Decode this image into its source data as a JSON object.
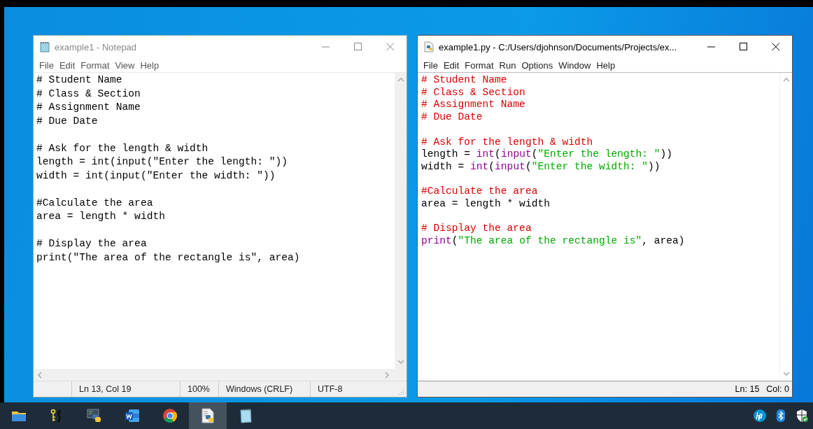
{
  "notepad": {
    "title": "example1 - Notepad",
    "active": false,
    "menu": [
      "File",
      "Edit",
      "Format",
      "View",
      "Help"
    ],
    "blocks": [
      [
        "# Student Name",
        "# Class & Section",
        "# Assignment Name",
        "# Due Date"
      ],
      [
        "# Ask for the length & width",
        "length = int(input(\"Enter the length: \"))",
        "width = int(input(\"Enter the width: \"))"
      ],
      [
        "#Calculate the area",
        "area = length * width"
      ],
      [
        "# Display the area",
        "print(\"The area of the rectangle is\", area)"
      ]
    ],
    "status": {
      "position": "Ln 13, Col 19",
      "zoom": "100%",
      "line_ending": "Windows (CRLF)",
      "encoding": "UTF-8"
    }
  },
  "idle": {
    "title": "example1.py - C:/Users/djohnson/Documents/Projects/ex...",
    "active": true,
    "menu": [
      "File",
      "Edit",
      "Format",
      "Run",
      "Options",
      "Window",
      "Help"
    ],
    "blocks": [
      [
        [
          {
            "kind": "comment",
            "text": "# Student Name"
          }
        ],
        [
          {
            "kind": "comment",
            "text": "# Class & Section"
          }
        ],
        [
          {
            "kind": "comment",
            "text": "# Assignment Name"
          }
        ],
        [
          {
            "kind": "comment",
            "text": "# Due Date"
          }
        ]
      ],
      [
        [
          {
            "kind": "comment",
            "text": "# Ask for the length & width"
          }
        ],
        [
          {
            "kind": "plain",
            "text": "length = "
          },
          {
            "kind": "builtin",
            "text": "int"
          },
          {
            "kind": "plain",
            "text": "("
          },
          {
            "kind": "builtin",
            "text": "input"
          },
          {
            "kind": "plain",
            "text": "("
          },
          {
            "kind": "string",
            "text": "\"Enter the length: \""
          },
          {
            "kind": "plain",
            "text": "))"
          }
        ],
        [
          {
            "kind": "plain",
            "text": "width = "
          },
          {
            "kind": "builtin",
            "text": "int"
          },
          {
            "kind": "plain",
            "text": "("
          },
          {
            "kind": "builtin",
            "text": "input"
          },
          {
            "kind": "plain",
            "text": "("
          },
          {
            "kind": "string",
            "text": "\"Enter the width: \""
          },
          {
            "kind": "plain",
            "text": "))"
          }
        ]
      ],
      [
        [
          {
            "kind": "comment",
            "text": "#Calculate the area"
          }
        ],
        [
          {
            "kind": "plain",
            "text": "area = length * width"
          }
        ]
      ],
      [
        [
          {
            "kind": "comment",
            "text": "# Display the area"
          }
        ],
        [
          {
            "kind": "builtin",
            "text": "print"
          },
          {
            "kind": "plain",
            "text": "("
          },
          {
            "kind": "string",
            "text": "\"The area of the rectangle is\""
          },
          {
            "kind": "plain",
            "text": ", area)"
          }
        ]
      ]
    ],
    "status": {
      "line": "Ln: 15",
      "column": "Col: 0"
    }
  },
  "taskbar": {
    "items": [
      {
        "kind": "folder",
        "selected": false
      },
      {
        "kind": "figure",
        "selected": false
      },
      {
        "kind": "python",
        "selected": false
      },
      {
        "kind": "word",
        "selected": false
      },
      {
        "kind": "chrome",
        "selected": false
      },
      {
        "kind": "pyfile",
        "selected": true
      },
      {
        "kind": "notepad",
        "selected": false
      }
    ],
    "tray": [
      {
        "kind": "hp"
      },
      {
        "kind": "bluetooth"
      },
      {
        "kind": "shield"
      }
    ]
  }
}
